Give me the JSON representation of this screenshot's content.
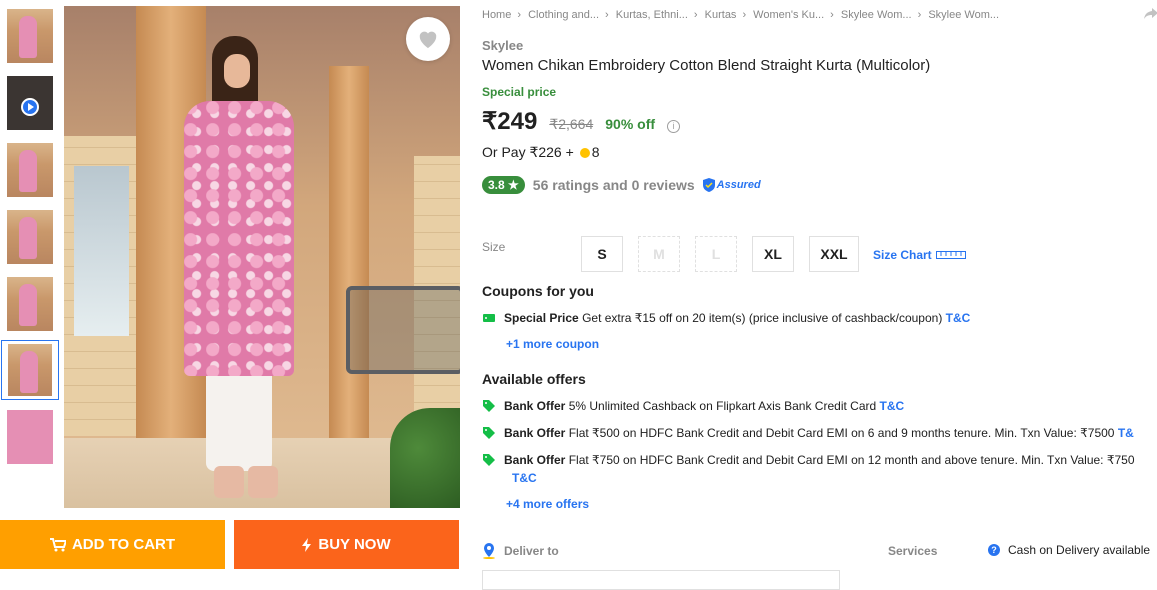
{
  "gallery": {
    "thumbnails": [
      "image-1",
      "video",
      "image-3",
      "image-4",
      "image-5",
      "image-6",
      "image-7"
    ],
    "selected_index": 5
  },
  "actions": {
    "add_to_cart": "ADD TO CART",
    "buy_now": "BUY NOW"
  },
  "breadcrumbs": [
    "Home",
    "Clothing and...",
    "Kurtas, Ethni...",
    "Kurtas",
    "Women's Ku...",
    "Skylee Wom...",
    "Skylee Wom..."
  ],
  "product": {
    "brand": "Skylee",
    "title": "Women Chikan Embroidery Cotton Blend Straight Kurta  (Multicolor)",
    "special_label": "Special price",
    "price": "₹249",
    "mrp": "₹2,664",
    "discount": "90% off",
    "or_pay_prefix": "Or Pay ₹226 +",
    "or_pay_coins": "8",
    "rating": "3.8",
    "rating_star": "★",
    "ratings_text": "56 ratings and 0 reviews",
    "assured": "Assured"
  },
  "sizes": {
    "label": "Size",
    "options": [
      "S",
      "M",
      "L",
      "XL",
      "XXL"
    ],
    "size_chart": "Size Chart"
  },
  "coupons": {
    "heading": "Coupons for you",
    "item_title": "Special Price",
    "item_text": "Get extra ₹15 off on 20 item(s) (price inclusive of cashback/coupon)",
    "tc": "T&C",
    "more": "+1 more coupon"
  },
  "offers": {
    "heading": "Available offers",
    "items": [
      {
        "title": "Bank Offer",
        "text": "5% Unlimited Cashback on Flipkart Axis Bank Credit Card",
        "tc": "T&C"
      },
      {
        "title": "Bank Offer",
        "text": "Flat ₹500 on HDFC Bank Credit and Debit Card EMI on 6 and 9 months tenure. Min. Txn Value: ₹7500",
        "tc": "T&"
      },
      {
        "title": "Bank Offer",
        "text": "Flat ₹750 on HDFC Bank Credit and Debit Card EMI on 12 month and above tenure. Min. Txn Value: ₹750",
        "tc": "T&C"
      }
    ],
    "more": "+4 more offers"
  },
  "delivery": {
    "label": "Deliver to",
    "services_label": "Services",
    "cod": "Cash on Delivery available"
  },
  "colors": {
    "accent": "#2874f0",
    "green": "#388e3c",
    "cart": "#ff9f00",
    "buy": "#fb641b"
  }
}
